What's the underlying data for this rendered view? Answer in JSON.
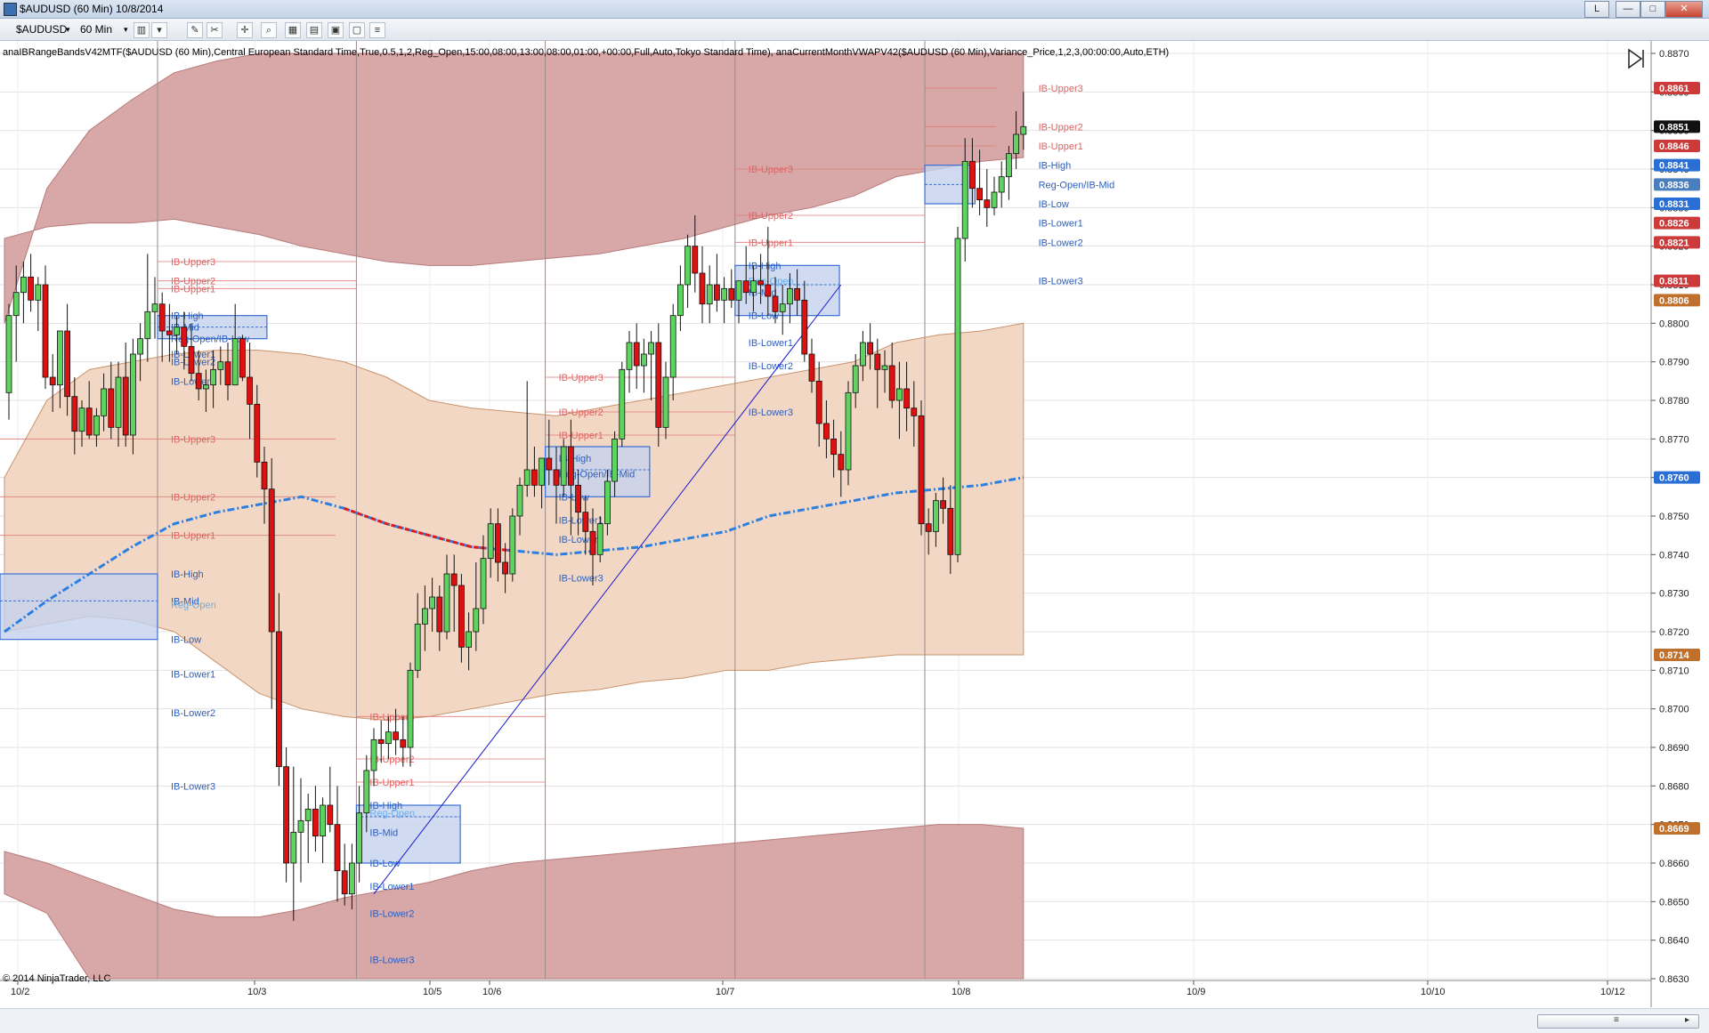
{
  "window": {
    "title": "$AUDUSD (60 Min)  10/8/2014",
    "buttons": [
      "L",
      "—",
      "□",
      "✕"
    ]
  },
  "toolbar": {
    "instrument": "$AUDUSD",
    "interval": "60 Min"
  },
  "indicator_label": "anaIBRangeBandsV42MTF($AUDUSD (60 Min),Central European Standard Time,True,0.5,1,2,Reg_Open,15:00,08:00,13:00,08:00,01:00,+00:00,Full,Auto,Tokyo Standard Time), anaCurrentMonthVWAPV42($AUDUSD (60 Min),Variance_Price,1,2,3,00:00:00,Auto,ETH)",
  "copyright": "© 2014 NinjaTrader, LLC",
  "colors": {
    "bull": "#5fd35f",
    "bear": "#dd1111",
    "band_outer": "#d8a8a8",
    "band_inner": "#f2d8c4",
    "ib_box": "#c4d2ee",
    "vwap_blue": "#2a7fe0",
    "vwap_red": "#e01818",
    "trendline": "#1a1ad0"
  },
  "chart_data": {
    "type": "candlestick",
    "y_range": [
      0.863,
      0.887
    ],
    "y_ticks": [
      "0.8870",
      "0.8860",
      "0.8850",
      "0.8840",
      "0.8830",
      "0.8820",
      "0.8810",
      "0.8800",
      "0.8790",
      "0.8780",
      "0.8770",
      "0.8760",
      "0.8750",
      "0.8740",
      "0.8730",
      "0.8720",
      "0.8710",
      "0.8700",
      "0.8690",
      "0.8680",
      "0.8670",
      "0.8660",
      "0.8650",
      "0.8640",
      "0.8630"
    ],
    "x_labels": [
      "10/2",
      "10/3",
      "10/5",
      "10/6",
      "10/7",
      "10/8",
      "10/9",
      "10/10",
      "10/12"
    ],
    "candles": [
      [
        0.8782,
        0.8805,
        0.8775,
        0.8802
      ],
      [
        0.8802,
        0.8815,
        0.879,
        0.8808
      ],
      [
        0.8808,
        0.8816,
        0.88,
        0.8812
      ],
      [
        0.8812,
        0.8818,
        0.8803,
        0.8806
      ],
      [
        0.8806,
        0.8812,
        0.8798,
        0.881
      ],
      [
        0.881,
        0.8815,
        0.8783,
        0.8786
      ],
      [
        0.8786,
        0.8792,
        0.8777,
        0.8784
      ],
      [
        0.8784,
        0.8795,
        0.8778,
        0.8798
      ],
      [
        0.8798,
        0.8805,
        0.8776,
        0.8781
      ],
      [
        0.8781,
        0.8786,
        0.8766,
        0.8772
      ],
      [
        0.8772,
        0.878,
        0.8768,
        0.8778
      ],
      [
        0.8778,
        0.8785,
        0.877,
        0.8771
      ],
      [
        0.8771,
        0.8778,
        0.8768,
        0.8776
      ],
      [
        0.8776,
        0.8787,
        0.8772,
        0.8783
      ],
      [
        0.8783,
        0.879,
        0.877,
        0.8773
      ],
      [
        0.8773,
        0.879,
        0.8768,
        0.8786
      ],
      [
        0.8786,
        0.8795,
        0.8768,
        0.8771
      ],
      [
        0.8771,
        0.8796,
        0.8766,
        0.8792
      ],
      [
        0.8792,
        0.88,
        0.8785,
        0.8796
      ],
      [
        0.8796,
        0.8818,
        0.879,
        0.8803
      ],
      [
        0.8803,
        0.8812,
        0.8796,
        0.8805
      ],
      [
        0.8805,
        0.8808,
        0.879,
        0.8798
      ],
      [
        0.8798,
        0.8805,
        0.879,
        0.8797
      ],
      [
        0.8797,
        0.8802,
        0.8792,
        0.8799
      ],
      [
        0.8799,
        0.8803,
        0.8788,
        0.8794
      ],
      [
        0.8794,
        0.88,
        0.8785,
        0.8787
      ],
      [
        0.8787,
        0.8793,
        0.878,
        0.8783
      ],
      [
        0.8783,
        0.8788,
        0.8777,
        0.8784
      ],
      [
        0.8784,
        0.8793,
        0.8778,
        0.8788
      ],
      [
        0.8788,
        0.8794,
        0.8784,
        0.879
      ],
      [
        0.879,
        0.8795,
        0.878,
        0.8784
      ],
      [
        0.8784,
        0.8805,
        0.8786,
        0.8796
      ],
      [
        0.8796,
        0.8797,
        0.8785,
        0.8786
      ],
      [
        0.8786,
        0.8795,
        0.877,
        0.8779
      ],
      [
        0.8779,
        0.8784,
        0.876,
        0.8764
      ],
      [
        0.8764,
        0.8768,
        0.8748,
        0.8757
      ],
      [
        0.8757,
        0.8765,
        0.87,
        0.872
      ],
      [
        0.872,
        0.873,
        0.868,
        0.8685
      ],
      [
        0.8685,
        0.869,
        0.8655,
        0.866
      ],
      [
        0.866,
        0.8685,
        0.8645,
        0.8668
      ],
      [
        0.8668,
        0.8682,
        0.8655,
        0.8671
      ],
      [
        0.8671,
        0.8678,
        0.866,
        0.8674
      ],
      [
        0.8674,
        0.868,
        0.8663,
        0.8667
      ],
      [
        0.8667,
        0.8677,
        0.866,
        0.8675
      ],
      [
        0.8675,
        0.8685,
        0.8668,
        0.867
      ],
      [
        0.867,
        0.868,
        0.865,
        0.8658
      ],
      [
        0.8658,
        0.8665,
        0.8649,
        0.8652
      ],
      [
        0.8652,
        0.8665,
        0.8648,
        0.866
      ],
      [
        0.866,
        0.868,
        0.8655,
        0.8673
      ],
      [
        0.8673,
        0.8688,
        0.8668,
        0.8684
      ],
      [
        0.8684,
        0.8695,
        0.868,
        0.8692
      ],
      [
        0.8692,
        0.8697,
        0.8686,
        0.8691
      ],
      [
        0.8691,
        0.8698,
        0.8687,
        0.8694
      ],
      [
        0.8694,
        0.87,
        0.8688,
        0.8692
      ],
      [
        0.8692,
        0.8698,
        0.8685,
        0.869
      ],
      [
        0.869,
        0.8712,
        0.8685,
        0.871
      ],
      [
        0.871,
        0.873,
        0.8708,
        0.8722
      ],
      [
        0.8722,
        0.8732,
        0.8715,
        0.8726
      ],
      [
        0.8726,
        0.8734,
        0.872,
        0.8729
      ],
      [
        0.8729,
        0.8732,
        0.8715,
        0.872
      ],
      [
        0.872,
        0.874,
        0.8718,
        0.8735
      ],
      [
        0.8735,
        0.874,
        0.872,
        0.8732
      ],
      [
        0.8732,
        0.8735,
        0.8712,
        0.8716
      ],
      [
        0.8716,
        0.8725,
        0.871,
        0.872
      ],
      [
        0.872,
        0.8738,
        0.8715,
        0.8726
      ],
      [
        0.8726,
        0.8745,
        0.8722,
        0.8739
      ],
      [
        0.8739,
        0.8752,
        0.8734,
        0.8748
      ],
      [
        0.8748,
        0.8752,
        0.8733,
        0.8738
      ],
      [
        0.8738,
        0.8743,
        0.873,
        0.8735
      ],
      [
        0.8735,
        0.8752,
        0.8733,
        0.875
      ],
      [
        0.875,
        0.876,
        0.8745,
        0.8758
      ],
      [
        0.8758,
        0.8785,
        0.8755,
        0.8762
      ],
      [
        0.8762,
        0.8768,
        0.8755,
        0.8758
      ],
      [
        0.8758,
        0.8765,
        0.8752,
        0.8765
      ],
      [
        0.8765,
        0.8775,
        0.8758,
        0.8762
      ],
      [
        0.8762,
        0.8768,
        0.8748,
        0.8758
      ],
      [
        0.8758,
        0.877,
        0.8755,
        0.8768
      ],
      [
        0.8768,
        0.8775,
        0.8745,
        0.8758
      ],
      [
        0.8758,
        0.8762,
        0.8745,
        0.8751
      ],
      [
        0.8751,
        0.8755,
        0.874,
        0.8746
      ],
      [
        0.8746,
        0.8752,
        0.8732,
        0.874
      ],
      [
        0.874,
        0.875,
        0.8738,
        0.8748
      ],
      [
        0.8748,
        0.8762,
        0.8745,
        0.8759
      ],
      [
        0.8759,
        0.8772,
        0.8755,
        0.877
      ],
      [
        0.877,
        0.879,
        0.8768,
        0.8788
      ],
      [
        0.8788,
        0.8798,
        0.8782,
        0.8795
      ],
      [
        0.8795,
        0.88,
        0.8783,
        0.8789
      ],
      [
        0.8789,
        0.8796,
        0.8782,
        0.8792
      ],
      [
        0.8792,
        0.8798,
        0.878,
        0.8795
      ],
      [
        0.8795,
        0.88,
        0.8768,
        0.8773
      ],
      [
        0.8773,
        0.879,
        0.877,
        0.8786
      ],
      [
        0.8786,
        0.8805,
        0.878,
        0.8802
      ],
      [
        0.8802,
        0.8815,
        0.8798,
        0.881
      ],
      [
        0.881,
        0.8823,
        0.8804,
        0.882
      ],
      [
        0.882,
        0.8828,
        0.8808,
        0.8813
      ],
      [
        0.8813,
        0.882,
        0.88,
        0.8805
      ],
      [
        0.8805,
        0.8815,
        0.88,
        0.881
      ],
      [
        0.881,
        0.8818,
        0.8803,
        0.8806
      ],
      [
        0.8806,
        0.8812,
        0.88,
        0.8809
      ],
      [
        0.8809,
        0.8814,
        0.8804,
        0.8806
      ],
      [
        0.8806,
        0.881,
        0.88,
        0.8811
      ],
      [
        0.8811,
        0.882,
        0.8805,
        0.8808
      ],
      [
        0.8808,
        0.8815,
        0.8803,
        0.8811
      ],
      [
        0.8811,
        0.8818,
        0.8805,
        0.881
      ],
      [
        0.881,
        0.8825,
        0.8802,
        0.8807
      ],
      [
        0.8807,
        0.8812,
        0.88,
        0.8803
      ],
      [
        0.8803,
        0.881,
        0.8797,
        0.8805
      ],
      [
        0.8805,
        0.8813,
        0.88,
        0.8809
      ],
      [
        0.8809,
        0.8814,
        0.8802,
        0.8806
      ],
      [
        0.8806,
        0.8811,
        0.879,
        0.8792
      ],
      [
        0.8792,
        0.8796,
        0.8782,
        0.8785
      ],
      [
        0.8785,
        0.879,
        0.8768,
        0.8774
      ],
      [
        0.8774,
        0.878,
        0.8765,
        0.877
      ],
      [
        0.877,
        0.8775,
        0.876,
        0.8766
      ],
      [
        0.8766,
        0.8772,
        0.8755,
        0.8762
      ],
      [
        0.8762,
        0.8785,
        0.8758,
        0.8782
      ],
      [
        0.8782,
        0.8792,
        0.8778,
        0.8789
      ],
      [
        0.8789,
        0.8798,
        0.8785,
        0.8795
      ],
      [
        0.8795,
        0.88,
        0.8788,
        0.8792
      ],
      [
        0.8792,
        0.8796,
        0.8778,
        0.8788
      ],
      [
        0.8788,
        0.8793,
        0.8782,
        0.8789
      ],
      [
        0.8789,
        0.8795,
        0.8778,
        0.878
      ],
      [
        0.878,
        0.879,
        0.877,
        0.8783
      ],
      [
        0.8783,
        0.879,
        0.8772,
        0.8778
      ],
      [
        0.8778,
        0.8785,
        0.8768,
        0.8776
      ],
      [
        0.8776,
        0.878,
        0.8745,
        0.8748
      ],
      [
        0.8748,
        0.8752,
        0.874,
        0.8746
      ],
      [
        0.8746,
        0.8756,
        0.8742,
        0.8754
      ],
      [
        0.8754,
        0.876,
        0.8748,
        0.8752
      ],
      [
        0.8752,
        0.8758,
        0.8735,
        0.874
      ],
      [
        0.874,
        0.8825,
        0.8738,
        0.8822
      ],
      [
        0.8822,
        0.8848,
        0.8816,
        0.8842
      ],
      [
        0.8842,
        0.8848,
        0.883,
        0.8835
      ],
      [
        0.8835,
        0.8845,
        0.8828,
        0.8832
      ],
      [
        0.8832,
        0.884,
        0.8825,
        0.883
      ],
      [
        0.883,
        0.8838,
        0.8828,
        0.8834
      ],
      [
        0.8834,
        0.8842,
        0.883,
        0.8838
      ],
      [
        0.8838,
        0.8846,
        0.8832,
        0.8844
      ],
      [
        0.8844,
        0.8855,
        0.884,
        0.8849
      ],
      [
        0.8849,
        0.886,
        0.8845,
        0.8851
      ]
    ],
    "right_axis_tags": [
      {
        "value": "0.8861",
        "price": 0.8861,
        "color": "#cc3a3a"
      },
      {
        "value": "0.8851",
        "price": 0.8851,
        "color": "#111111"
      },
      {
        "value": "0.8846",
        "price": 0.8846,
        "color": "#cc3a3a"
      },
      {
        "value": "0.8841",
        "price": 0.8841,
        "color": "#2a6fd6"
      },
      {
        "value": "0.8836",
        "price": 0.8836,
        "color": "#4a7fbf"
      },
      {
        "value": "0.8831",
        "price": 0.8831,
        "color": "#2a6fd6"
      },
      {
        "value": "0.8826",
        "price": 0.8826,
        "color": "#cc3a3a"
      },
      {
        "value": "0.8821",
        "price": 0.8821,
        "color": "#cc3a3a"
      },
      {
        "value": "0.8811",
        "price": 0.8811,
        "color": "#cc3a3a"
      },
      {
        "value": "0.8806",
        "price": 0.8806,
        "color": "#c0702a"
      },
      {
        "value": "0.8760",
        "price": 0.876,
        "color": "#2a6fd6"
      },
      {
        "value": "0.8714",
        "price": 0.8714,
        "color": "#c0702a"
      },
      {
        "value": "0.8669",
        "price": 0.8669,
        "color": "#c0702a"
      }
    ],
    "ib_sessions": [
      {
        "high": 0.8735,
        "low": 0.8718,
        "regopen": 0.8728,
        "labels": [
          [
            "IB-Upper3",
            0.877
          ],
          [
            "IB-Upper2",
            0.8755
          ],
          [
            "IB-Upper1",
            0.8745
          ],
          [
            "IB-High",
            0.8735
          ],
          [
            "IB-Mid",
            0.8728
          ],
          [
            "Reg-Open",
            0.8727
          ],
          [
            "IB-Low",
            0.8718
          ],
          [
            "IB-Lower1",
            0.8709
          ],
          [
            "IB-Lower2",
            0.8699
          ],
          [
            "IB-Lower3",
            0.868
          ]
        ]
      },
      {
        "high": 0.8802,
        "low": 0.8796,
        "regopen": 0.8799,
        "labels": [
          [
            "IB-Upper3",
            0.8816
          ],
          [
            "IB-Upper2",
            0.8811
          ],
          [
            "IB-Upper1",
            0.8809
          ],
          [
            "IB-High",
            0.8802
          ],
          [
            "IB-Mid",
            0.8799
          ],
          [
            "Reg-Open/IB-Low",
            0.8796
          ],
          [
            "IB-Lower1",
            0.8792
          ],
          [
            "IB-Lower2",
            0.879
          ],
          [
            "IB-Lower3",
            0.8785
          ]
        ]
      },
      {
        "high": 0.8675,
        "low": 0.866,
        "regopen": 0.8672,
        "labels": [
          [
            "IB-Upper3",
            0.8698
          ],
          [
            "IB-Upper2",
            0.8687
          ],
          [
            "IB-Upper1",
            0.8681
          ],
          [
            "IB-High",
            0.8675
          ],
          [
            "Reg-Open",
            0.8673
          ],
          [
            "IB-Mid",
            0.8668
          ],
          [
            "IB-Low",
            0.866
          ],
          [
            "IB-Lower1",
            0.8654
          ],
          [
            "IB-Lower2",
            0.8647
          ],
          [
            "IB-Lower3",
            0.8635
          ]
        ]
      },
      {
        "high": 0.8768,
        "low": 0.8755,
        "regopen": 0.8762,
        "labels": [
          [
            "IB-Upper3",
            0.8786
          ],
          [
            "IB-Upper2",
            0.8777
          ],
          [
            "IB-Upper1",
            0.8771
          ],
          [
            "IB-High",
            0.8765
          ],
          [
            "Reg-Open/IB-Mid",
            0.8761
          ],
          [
            "IB-Low",
            0.8755
          ],
          [
            "IB-Lower1",
            0.8749
          ],
          [
            "IB-Lower2",
            0.8744
          ],
          [
            "IB-Lower3",
            0.8734
          ]
        ]
      },
      {
        "high": 0.8815,
        "low": 0.8802,
        "regopen": 0.881,
        "labels": [
          [
            "IB-Upper3",
            0.884
          ],
          [
            "IB-Upper2",
            0.8828
          ],
          [
            "IB-Upper1",
            0.8821
          ],
          [
            "IB-High",
            0.8815
          ],
          [
            "Reg-Open",
            0.8811
          ],
          [
            "IB-Mid",
            0.8808
          ],
          [
            "IB-Low",
            0.8802
          ],
          [
            "IB-Lower1",
            0.8795
          ],
          [
            "IB-Lower2",
            0.8789
          ],
          [
            "IB-Lower3",
            0.8777
          ]
        ]
      },
      {
        "high": 0.8841,
        "low": 0.8831,
        "regopen": 0.8836,
        "labels": [
          [
            "IB-Upper3",
            0.8861
          ],
          [
            "IB-Upper2",
            0.8851
          ],
          [
            "IB-Upper1",
            0.8846
          ],
          [
            "IB-High",
            0.8841
          ],
          [
            "Reg-Open/IB-Mid",
            0.8836
          ],
          [
            "IB-Low",
            0.8831
          ],
          [
            "IB-Lower1",
            0.8826
          ],
          [
            "IB-Lower2",
            0.8821
          ],
          [
            "IB-Lower3",
            0.8811
          ]
        ]
      }
    ]
  }
}
